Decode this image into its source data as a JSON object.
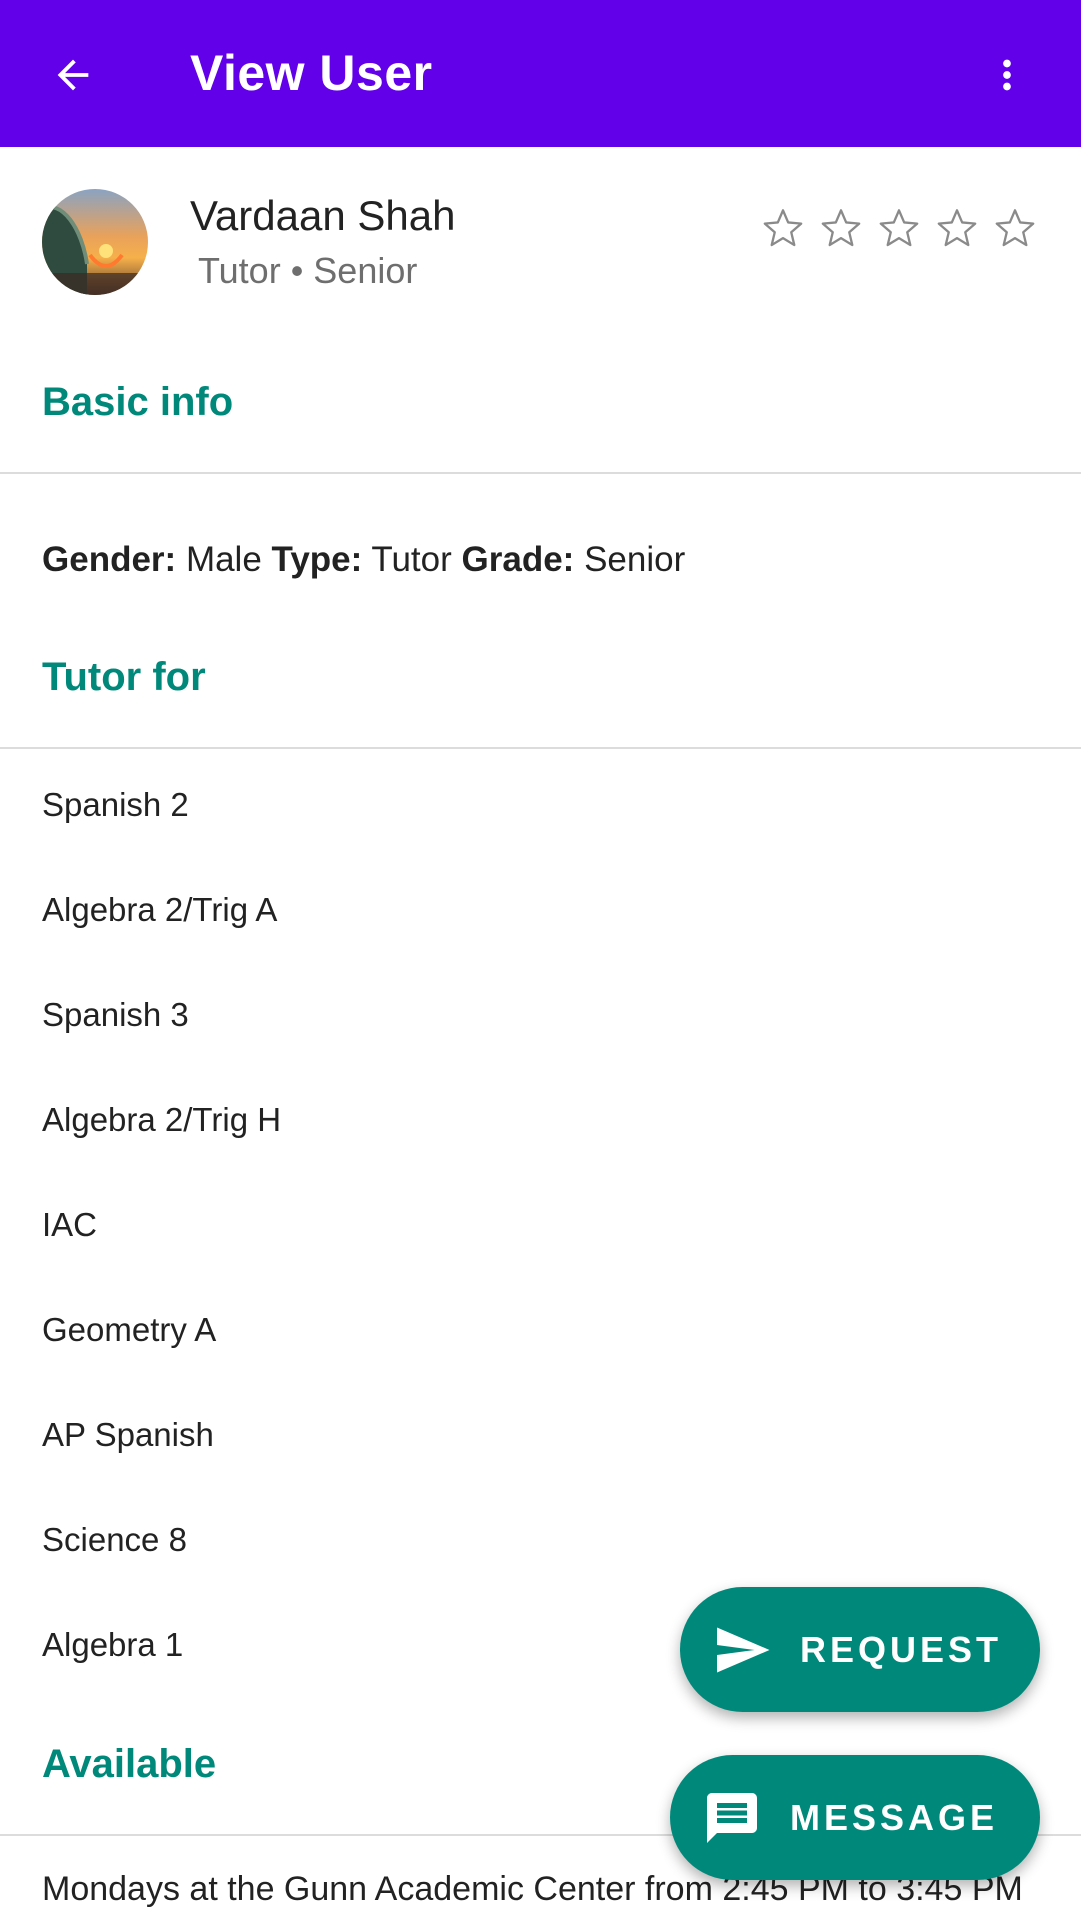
{
  "app_bar": {
    "title": "View User",
    "back_icon": "arrow-back-icon",
    "more_icon": "more-vert-icon",
    "color": "#6200ea"
  },
  "profile": {
    "name": "Vardaan Shah",
    "subtitle": "Tutor • Senior",
    "rating": {
      "value": 0,
      "max": 5
    }
  },
  "basic_info": {
    "heading": "Basic info",
    "gender_label": "Gender:",
    "gender_value": "Male",
    "type_label": "Type:",
    "type_value": "Tutor",
    "grade_label": "Grade:",
    "grade_value": "Senior"
  },
  "tutor_for": {
    "heading": "Tutor for",
    "subjects": [
      "Spanish 2",
      "Algebra 2/Trig A",
      "Spanish 3",
      "Algebra 2/Trig H",
      "IAC",
      "Geometry A",
      "AP Spanish",
      "Science 8",
      "Algebra 1"
    ]
  },
  "available": {
    "heading": "Available",
    "items": [
      "Mondays at the Gunn Academic Center from 2:45 PM to 3:45 PM"
    ]
  },
  "fabs": {
    "request_label": "REQUEST",
    "request_icon": "send-icon",
    "message_label": "MESSAGE",
    "message_icon": "message-icon",
    "color": "#00897b"
  },
  "accent_color": "#00897b"
}
